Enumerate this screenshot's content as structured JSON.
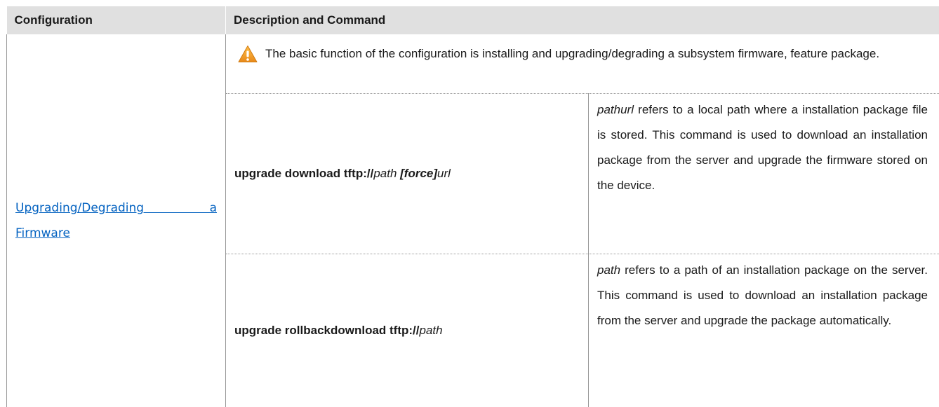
{
  "table": {
    "headers": {
      "configuration": "Configuration",
      "description": "Description and Command"
    },
    "config_link": {
      "line1": "Upgrading/Degrading a",
      "line2": "Firmware"
    },
    "note": "The basic function of the configuration is installing and upgrading/degrading a subsystem firmware, feature package.",
    "commands": [
      {
        "syntax_bold": "upgrade download tftp://",
        "syntax_arg": "path",
        "syntax_opt": "[force]",
        "syntax_tail": "url",
        "desc_term": "pathurl",
        "desc_rest": " refers to a local path where a installation package file is stored. This command is used to download an installation package from the server and upgrade the firmware stored on the device."
      },
      {
        "syntax_bold": "upgrade rollbackdownload tftp://",
        "syntax_arg": "path",
        "desc_term": "path",
        "desc_rest": " refers to a path of an installation package on the server. This command is used to download an installation package from the server and upgrade the package automatically."
      }
    ]
  },
  "colors": {
    "header_bg": "#e0e0e0",
    "link": "#0563c1",
    "warning": "#f5a623"
  },
  "icons": {
    "note": "warning-triangle-icon"
  }
}
